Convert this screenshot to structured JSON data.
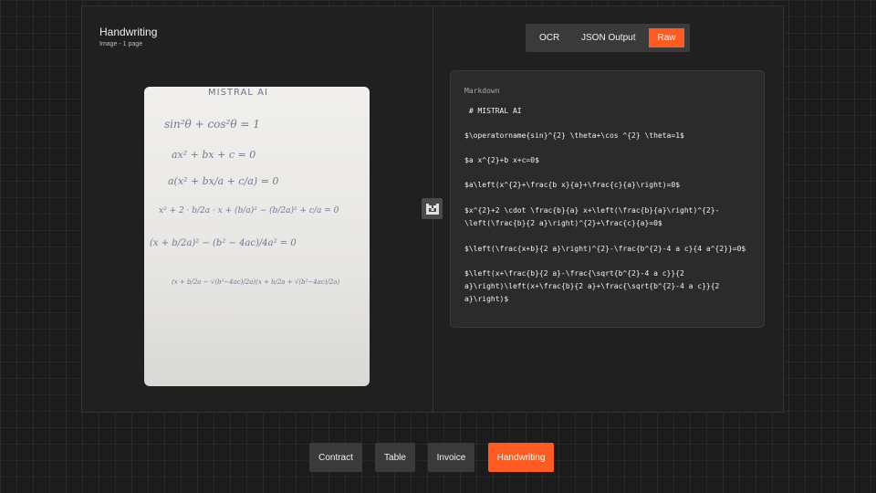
{
  "document": {
    "title": "Handwriting",
    "subtitle": "Image - 1 page",
    "paper_heading": "MISTRAL AI",
    "handwritten_lines": [
      "sin²θ +  cos²θ  =  1",
      "ax² + bx + c  = 0",
      "a(x² + bx/a + c/a) = 0",
      "x² + 2 · b/2a · x + (b/a)² − (b/2a)² + c/a = 0",
      "(x + b/2a)² −  (b² − 4ac)/4a²  =  0",
      "(x + b/2a − √(b²−4ac)/2a)(x + b/2a + √(b²−4ac)/2a)"
    ]
  },
  "view_toggle": {
    "options": [
      "OCR",
      "JSON Output",
      "Raw"
    ],
    "active": "Raw"
  },
  "markdown": {
    "label": "Markdown",
    "lines": [
      " # MISTRAL AI",
      "$\\operatorname{sin}^{2} \\theta+\\cos ^{2} \\theta=1$",
      "$a x^{2}+b x+c=0$",
      "$a\\left(x^{2}+\\frac{b x}{a}+\\frac{c}{a}\\right)=0$",
      "$x^{2}+2 \\cdot \\frac{b}{a} x+\\left(\\frac{b}{a}\\right)^{2}-",
      "\\left(\\frac{b}{2 a}\\right)^{2}+\\frac{c}{a}=0$",
      "$\\left(\\frac{x+b}{2 a}\\right)^{2}-\\frac{b^{2}-4 a c}{4 a^{2}}=0$",
      "$\\left(x+\\frac{b}{2 a}-\\frac{\\sqrt{b^{2}-4 a c}}{2",
      "a}\\right)\\left(x+\\frac{b}{2 a}+\\frac{\\sqrt{b^{2}-4 a c}}{2",
      "a}\\right)$"
    ]
  },
  "sample_tabs": {
    "items": [
      "Contract",
      "Table",
      "Invoice",
      "Handwriting"
    ],
    "active": "Handwriting"
  },
  "colors": {
    "accent": "#ff5a1f",
    "background": "#1c1c1c",
    "card": "#2b2b2b"
  }
}
